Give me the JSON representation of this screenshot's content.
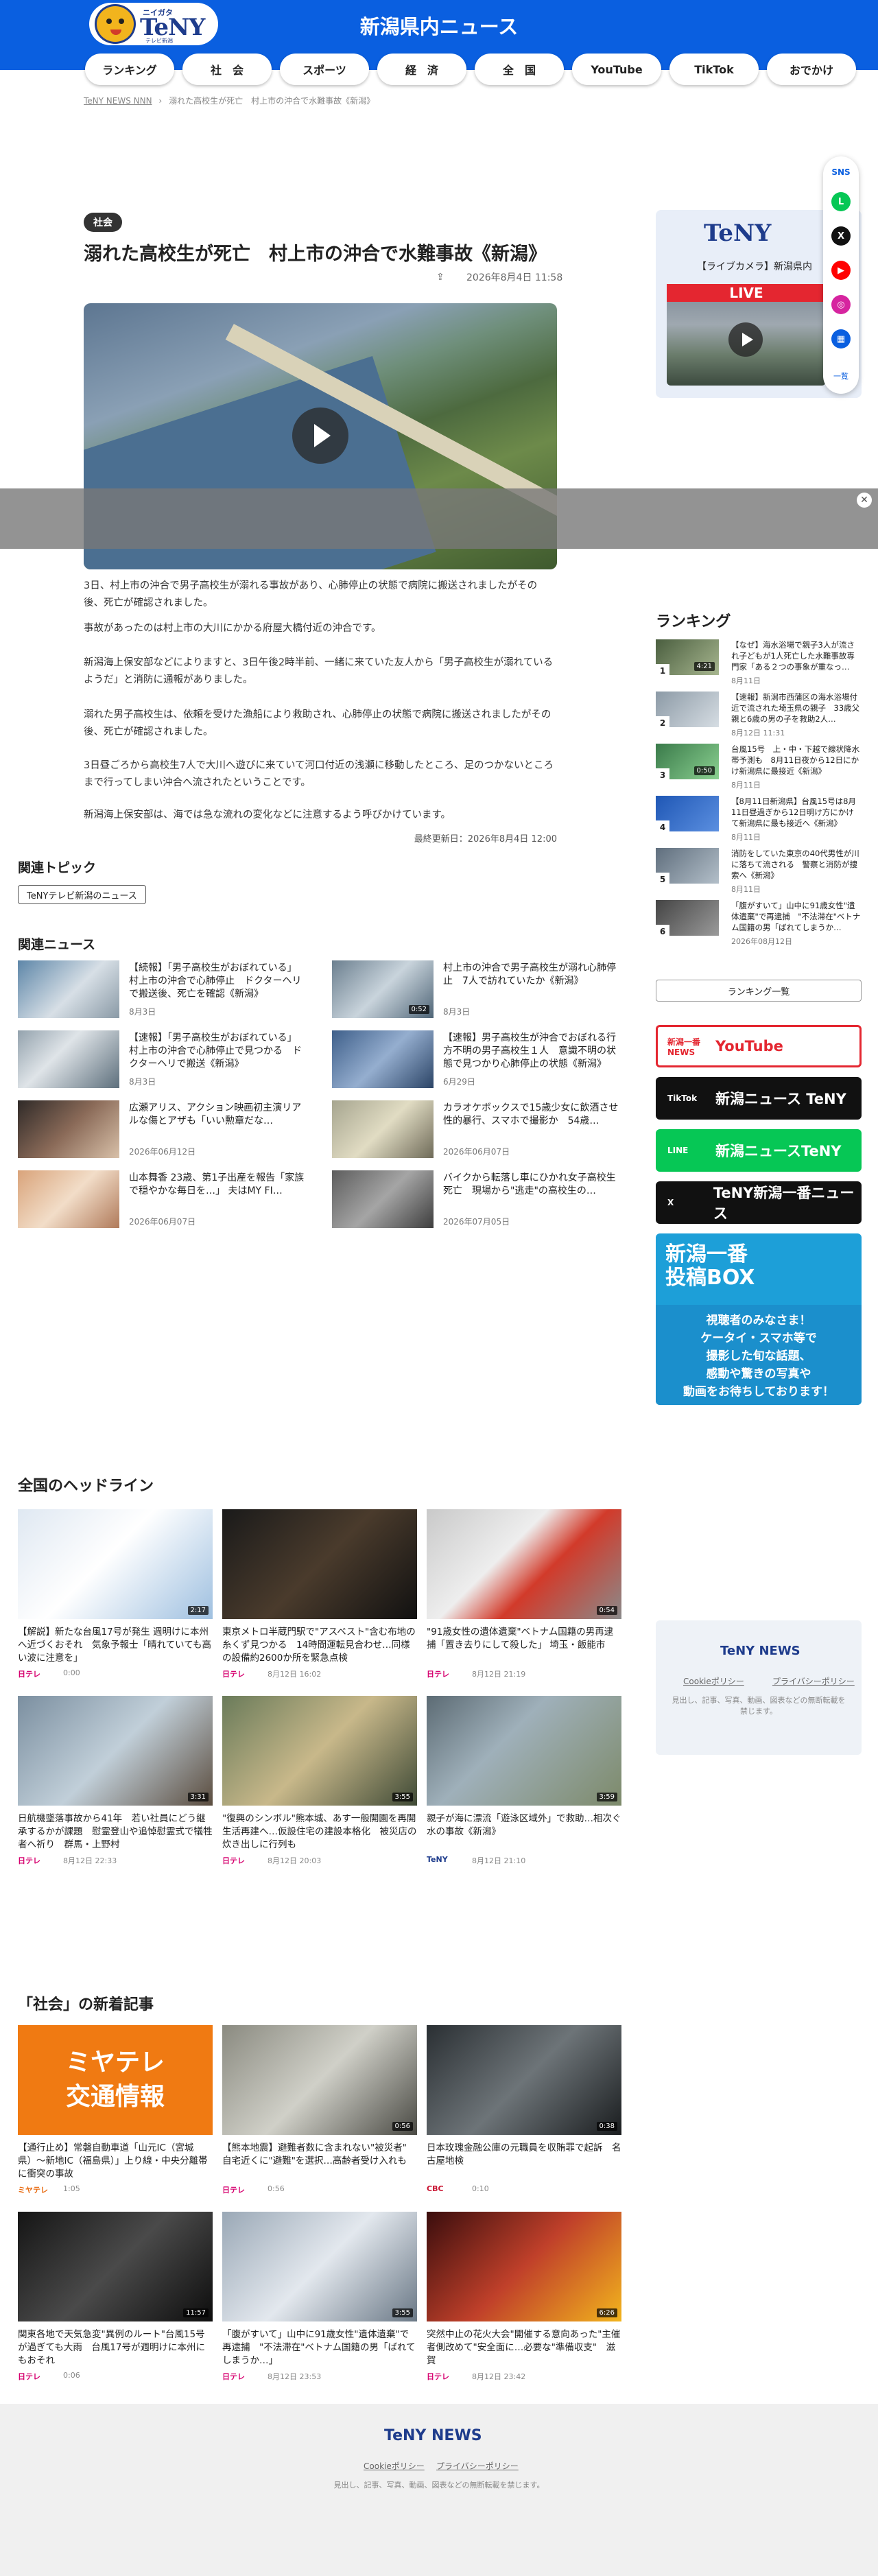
{
  "header": {
    "title": "新潟県内ニュース",
    "logo_small": "ニイガタ",
    "logo_text": "TeNY",
    "logo_sub": "テレビ新潟",
    "brand_color": "#0a5fe0"
  },
  "nav": [
    {
      "label": "ランキング",
      "w": 112
    },
    {
      "label": "社　会",
      "w": 112
    },
    {
      "label": "スポーツ",
      "w": 112
    },
    {
      "label": "経　済",
      "w": 112
    },
    {
      "label": "全　国",
      "w": 112
    },
    {
      "label": "YouTube",
      "w": 112
    },
    {
      "label": "TikTok",
      "w": 112
    },
    {
      "label": "おでかけ",
      "w": 112
    }
  ],
  "breadcrumb": [
    "TeNY NEWS NNN",
    "›",
    "溺れた高校生が死亡　村上市の沖合で水難事故《新潟》"
  ],
  "article": {
    "category": "社会",
    "title": "溺れた高校生が死亡　村上市の沖合で水難事故《新潟》",
    "date": "2026年8月4日 11:58",
    "paragraphs": [
      "3日、村上市の沖合で男子高校生が溺れる事故があり、心肺停止の状態で病院に搬送されましたがその後、死亡が確認されました。",
      "事故があったのは村上市の大川にかかる府屋大橋付近の沖合です。",
      "新潟海上保安部などによりますと、3日午後2時半前、一緒に来ていた友人から「男子高校生が溺れているようだ」と消防に通報がありました。",
      "溺れた男子高校生は、依頼を受けた漁船により救助され、心肺停止の状態で病院に搬送されましたがその後、死亡が確認されました。",
      "3日昼ごろから高校生7人で大川へ遊びに来ていて河口付近の浅瀬に移動したところ、足のつかないところまで行ってしまい沖合へ流されたということです。",
      "新潟海上保安部は、海では急な流れの変化などに注意するよう呼びかけています。"
    ],
    "updated": "最終更新日：2026年8月4日 12:00"
  },
  "related_topic": {
    "heading": "関連トピック",
    "tag": "TeNYテレビ新潟のニュース"
  },
  "related_news": {
    "heading": "関連ニュース",
    "items": [
      {
        "title": "【続報】「男子高校生がおぼれている」村上市の沖合で心肺停止　ドクターヘリで搬送後、死亡を確認《新潟》",
        "date": "8月3日",
        "dur": ""
      },
      {
        "title": "村上市の沖合で男子高校生が溺れ心肺停止　7人で訪れていたか《新潟》",
        "date": "8月3日",
        "dur": "0:52"
      },
      {
        "title": "【速報】「男子高校生がおぼれている」村上市の沖合で心肺停止で見つかる　ドクターヘリで搬送《新潟》",
        "date": "8月3日",
        "dur": ""
      },
      {
        "title": "【速報】男子高校生が沖合でおぼれる行方不明の男子高校生１人　意識不明の状態で見つかり心肺停止の状態《新潟》",
        "date": "6月29日",
        "dur": ""
      },
      {
        "title": "広瀬アリス、アクション映画初主演リアルな傷とアザも「いい勲章だな…",
        "date": "2026年06月12日",
        "dur": ""
      },
      {
        "title": "カラオケボックスで15歳少女に飲酒させ性的暴行、スマホで撮影か　54歳…",
        "date": "2026年06月07日",
        "dur": ""
      },
      {
        "title": "山本舞香 23歳、第1子出産を報告「家族で穏やかな毎日を…」 夫はMY FI…",
        "date": "2026年06月07日",
        "dur": ""
      },
      {
        "title": "バイクから転落し車にひかれ女子高校生死亡　現場から\"逃走\"の高校生の…",
        "date": "2026年07月05日",
        "dur": ""
      }
    ]
  },
  "live": {
    "caption": "【ライブカメラ】新潟県内",
    "tag": "LIVE"
  },
  "sns": {
    "label": "SNS",
    "more": "一覧",
    "icons": [
      {
        "name": "line-icon",
        "glyph": "L",
        "color": "#06c755"
      },
      {
        "name": "x-icon",
        "glyph": "X",
        "color": "#111111"
      },
      {
        "name": "youtube-icon",
        "glyph": "▶",
        "color": "#ff0000"
      },
      {
        "name": "instagram-icon",
        "glyph": "◎",
        "color": "#d6249f"
      },
      {
        "name": "grid-icon",
        "glyph": "▦",
        "color": "#0a5fe0"
      }
    ]
  },
  "ranking": {
    "heading": "ランキング",
    "items": [
      {
        "num": "1",
        "title": "【なぜ】海水浴場で親子3人が流され子どもが1人死亡した水難事故専門家「ある２つの事象が重なっ…",
        "date": "8月11日",
        "dur": "4:21"
      },
      {
        "num": "2",
        "title": "【速報】新潟市西蒲区の海水浴場付近で流された埼玉県の親子　33歳父親と6歳の男の子を救助2人…",
        "date": "8月12日 11:31",
        "dur": ""
      },
      {
        "num": "3",
        "title": "台風15号　上・中・下越で線状降水帯予測も　8月11日夜から12日にかけ新潟県に最接近《新潟》",
        "date": "8月11日",
        "dur": "0:50"
      },
      {
        "num": "4",
        "title": "【8月11日新潟県】台風15号は8月11日昼過ぎから12日明け方にかけて新潟県に最も接近へ《新潟》",
        "date": "8月11日",
        "dur": ""
      },
      {
        "num": "5",
        "title": "消防をしていた東京の40代男性が川に落ちて流される　警察と消防が捜索へ《新潟》",
        "date": "8月11日",
        "dur": ""
      },
      {
        "num": "6",
        "title": "「腹がすいて」山中に91歳女性\"遺体遺棄\"で再逮捕　\"不法滞在\"ベトナム国籍の男「ばれてしまうか…",
        "date": "2026年08月12日",
        "dur": ""
      }
    ],
    "more_button": "ランキング一覧"
  },
  "banners": [
    {
      "label": "YouTube",
      "sub": "新潟一番 NEWS",
      "bg": "#ffffff",
      "fg": "#e42630",
      "border": "#e42630"
    },
    {
      "label": "新潟ニュース TeNY",
      "sub": "TikTok",
      "bg": "#111111",
      "fg": "#ffffff",
      "border": "#111111"
    },
    {
      "label": "新潟ニュースTeNY",
      "sub": "LINE",
      "bg": "#06c755",
      "fg": "#ffffff",
      "border": "#06c755"
    },
    {
      "label": "TeNY新潟一番ニュース",
      "sub": "X",
      "bg": "#111111",
      "fg": "#ffffff",
      "border": "#111111"
    }
  ],
  "post_box": {
    "title": "新潟一番\n投稿BOX",
    "body": "視聴者のみなさま！\nケータイ・スマホ等で\n撮影した旬な話題、\n感動や驚きの写真や\n動画をお待ちしております！"
  },
  "national": {
    "heading": "全国のヘッドライン",
    "items": [
      {
        "title": "【解説】新たな台風17号が発生 週明けに本州へ近づくおそれ　気象予報士「晴れていても高い波に注意を」",
        "src": "日テレ",
        "src_color": "#d6006f",
        "date": "0:00",
        "dur": "2:17"
      },
      {
        "title": "東京メトロ半蔵門駅で\"アスベスト\"含む布地の糸くず見つかる　14時間運転見合わせ…同様の設備約2600か所を緊急点検",
        "src": "日テレ",
        "src_color": "#d6006f",
        "date": "8月12日 16:02",
        "dur": ""
      },
      {
        "title": "\"91歳女性の遺体遺棄\"ベトナム国籍の男再逮捕「置き去りにして殺した」 埼玉・飯能市",
        "src": "日テレ",
        "src_color": "#d6006f",
        "date": "8月12日 21:19",
        "dur": "0:54"
      },
      {
        "title": "日航機墜落事故から41年　若い社員にどう継承するかが課題　慰霊登山や追悼慰霊式で犠牲者へ祈り　群馬・上野村",
        "src": "日テレ",
        "src_color": "#d6006f",
        "date": "8月12日 22:33",
        "dur": "3:31"
      },
      {
        "title": "\"復興のシンボル\"熊本城、あす一般開園を再開　生活再建へ…仮設住宅の建設本格化　被災店の炊き出しに行列も",
        "src": "日テレ",
        "src_color": "#d6006f",
        "date": "8月12日 20:03",
        "dur": "3:55"
      },
      {
        "title": "親子が海に漂流「遊泳区域外」で救助…相次ぐ水の事故《新潟》",
        "src": "TeNY",
        "src_color": "#1e3c8c",
        "date": "8月12日 21:10",
        "dur": "3:59"
      }
    ]
  },
  "society": {
    "heading": "「社会」の新着記事",
    "items": [
      {
        "title": "【通行止め】常磐自動車道「山元IC（宮城県）〜新地IC（福島県）」上り線・中央分離帯に衝突の事故",
        "src": "ミヤテレ",
        "src_color": "#e86a10",
        "date": "1:05",
        "dur": ""
      },
      {
        "title": "【熊本地震】避難者数に含まれない\"被災者\"　自宅近くに\"避難\"を選択…高齢者受け入れも",
        "src": "日テレ",
        "src_color": "#d6006f",
        "date": "0:56",
        "dur": "0:56"
      },
      {
        "title": "日本玫瑰金融公庫の元職員を収賄罪で起訴　名古屋地検",
        "src": "CBC",
        "src_color": "#c8102e",
        "date": "0:10",
        "dur": "0:38"
      },
      {
        "title": "関東各地で天気急変\"異例のルート\"台風15号が過ぎても大雨　台風17号が週明けに本州にもおそれ",
        "src": "日テレ",
        "src_color": "#d6006f",
        "date": "0:06",
        "dur": "11:57"
      },
      {
        "title": "「腹がすいて」山中に91歳女性\"遺体遺棄\"で再逮捕　\"不法滞在\"ベトナム国籍の男「ばれてしまうか…」",
        "src": "日テレ",
        "src_color": "#d6006f",
        "date": "8月12日 23:53",
        "dur": "3:55"
      },
      {
        "title": "突然中止の花火大会\"開催する意向あった\"主催者側改めて\"安全面に…必要な\"準備収支\"　滋賀",
        "src": "日テレ",
        "src_color": "#d6006f",
        "date": "8月12日 23:42",
        "dur": "6:26"
      }
    ],
    "miyatele_label": "ミヤテレ\n交通情報"
  },
  "footer": {
    "logo": "TeNY NEWS",
    "links": [
      "Cookieポリシー",
      "プライバシーポリシー"
    ],
    "note": "見出し、記事、写真、動画、図表などの無断転載を禁じます。",
    "note_sidebar": "見出し、記事、写真、動画、図表などの無断転載を禁じます。"
  }
}
